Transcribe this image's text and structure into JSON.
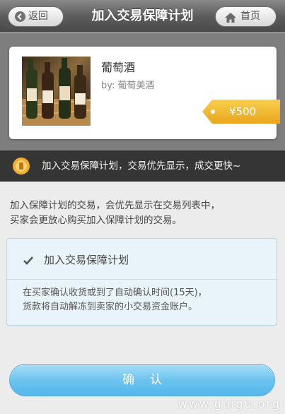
{
  "header": {
    "title": "加入交易保障计划",
    "back_label": "返回",
    "home_label": "首页"
  },
  "product": {
    "name": "葡萄酒",
    "seller": "by: 葡萄美酒",
    "price": "¥500",
    "image": "wine-bottles-photo"
  },
  "banner": {
    "text": "加入交易保障计划，交易优先显示，成交更快~",
    "icon": "badge-icon"
  },
  "description": {
    "line1": "加入保障计划的交易，会优先显示在交易列表中，",
    "line2": "买家会更放心购买加入保障计划的交易。"
  },
  "option": {
    "checked": true,
    "label": "加入交易保障计划",
    "detail_line1": "在买家确认收货或到了自动确认时间(15天)，",
    "detail_line2": "货款将自动解冻到卖家的小交易资金账户。"
  },
  "confirm_button": {
    "label": "确认"
  },
  "watermark": "www.guigu.org",
  "colors": {
    "header": "#5d5d5d",
    "price_tag": "#f0b429",
    "confirm": "#6cc4ef",
    "option_bg": "#e8f4fa"
  }
}
